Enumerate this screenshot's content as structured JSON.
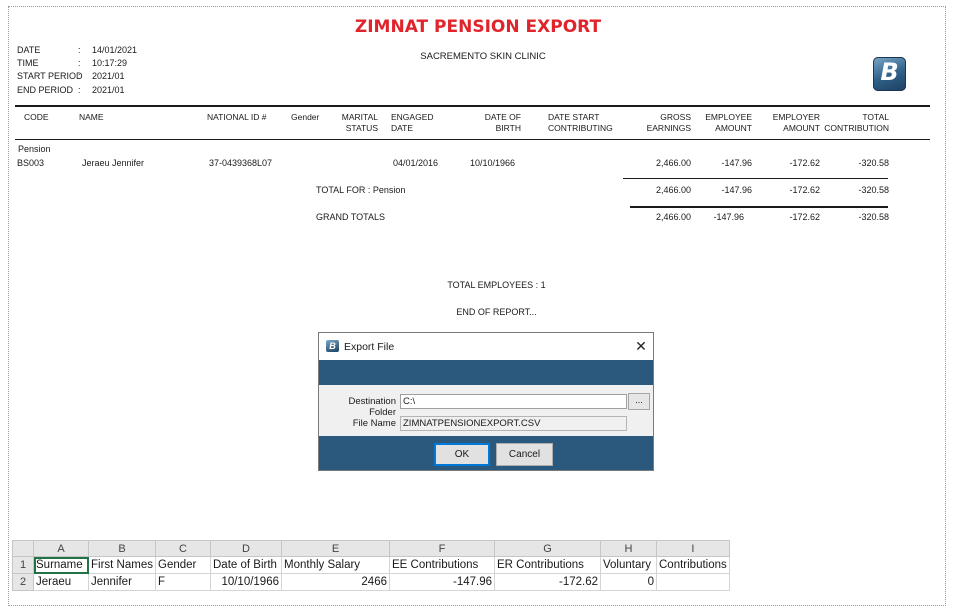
{
  "report": {
    "title": "ZIMNAT PENSION EXPORT",
    "company": "SACREMENTO SKIN CLINIC",
    "meta": [
      {
        "label": "DATE",
        "value": "14/01/2021"
      },
      {
        "label": "TIME",
        "value": "10:17:29"
      },
      {
        "label": "START PERIOD",
        "value": "2021/01"
      },
      {
        "label": "END PERIOD",
        "value": "2021/01"
      }
    ],
    "columns": {
      "code": "CODE",
      "name": "NAME",
      "national_id": "NATIONAL ID #",
      "gender": "Gender",
      "marital_1": "MARITAL",
      "marital_2": "STATUS",
      "engaged_1": "ENGAGED",
      "engaged_2": "DATE",
      "dob_1": "DATE OF",
      "dob_2": "BIRTH",
      "start_1": "DATE START",
      "start_2": "CONTRIBUTING",
      "gross_1": "GROSS",
      "gross_2": "EARNINGS",
      "employee_1": "EMPLOYEE",
      "employee_2": "AMOUNT",
      "employer_1": "EMPLOYER",
      "employer_2": "AMOUNT",
      "total_1": "TOTAL",
      "total_2": "CONTRIBUTION"
    },
    "group": "Pension",
    "row": {
      "code": "BS003",
      "name": "Jeraeu Jennifer",
      "national_id": "37-0439368L07",
      "engaged": "04/01/2016",
      "dob": "10/10/1966",
      "gross": "2,466.00",
      "employee": "-147.96",
      "employer": "-172.62",
      "total": "-320.58"
    },
    "group_total": {
      "label": "TOTAL FOR : Pension",
      "gross": "2,466.00",
      "employee": "-147.96",
      "employer": "-172.62",
      "total": "-320.58"
    },
    "grand_total": {
      "label": "GRAND TOTALS",
      "gross": "2,466.00",
      "employee": "-147.96",
      "employer": "-172.62",
      "total": "-320.58"
    },
    "total_employees": "TOTAL EMPLOYEES : 1",
    "end": "END OF REPORT..."
  },
  "logo_icon": "b-logo-icon",
  "dialog": {
    "title": "Export File",
    "close_glyph": "✕",
    "destination_label": "Destination Folder",
    "destination_value": "C:\\",
    "browse_label": "...",
    "filename_label": "File Name",
    "filename_value": "ZIMNATPENSIONEXPORT.CSV",
    "ok_label": "OK",
    "cancel_label": "Cancel",
    "accent": "#2b587d"
  },
  "sheet": {
    "col_letters": [
      "",
      "A",
      "B",
      "C",
      "D",
      "E",
      "F",
      "G",
      "H",
      "I"
    ],
    "rows": [
      {
        "num": "1",
        "cells": [
          "Surname",
          "First Names",
          "Gender",
          "Date of Birth",
          "Monthly Salary",
          "EE Contributions",
          "ER Contributions",
          "Voluntary",
          "Contributions"
        ]
      },
      {
        "num": "2",
        "cells": [
          "Jeraeu",
          "Jennifer",
          "F",
          "10/10/1966",
          "2466",
          "-147.96",
          "-172.62",
          "0",
          ""
        ]
      }
    ],
    "accent": "#217346"
  }
}
